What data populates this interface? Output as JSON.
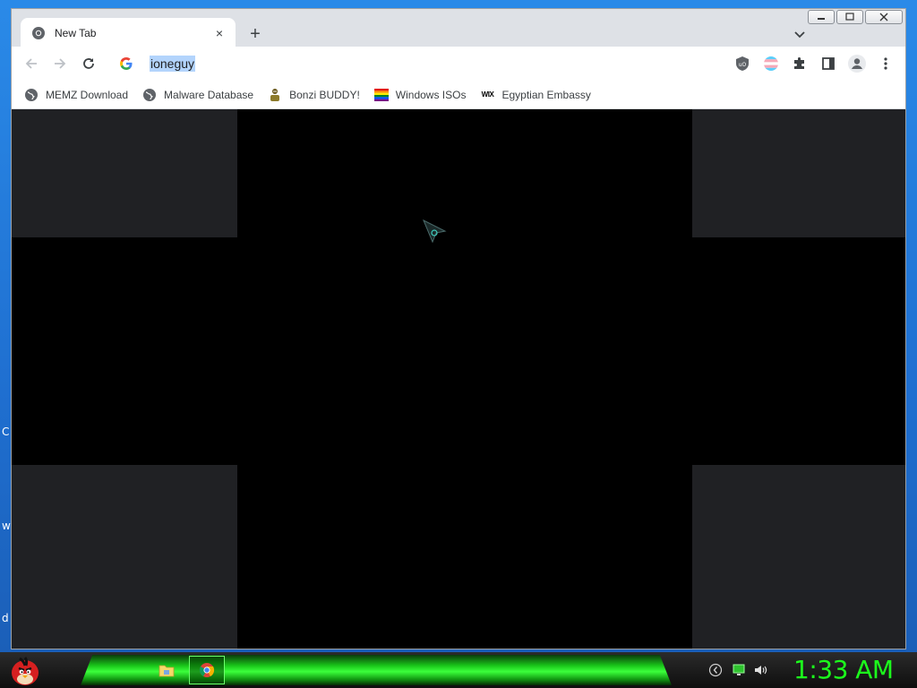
{
  "desktop": {
    "fragments": [
      "C",
      "w",
      "d"
    ]
  },
  "window": {
    "tab": {
      "title": "New Tab",
      "close_glyph": "×"
    },
    "new_tab_glyph": "+",
    "omnibox": {
      "value": "ioneguy"
    },
    "bookmarks": [
      {
        "label": "MEMZ Download",
        "icon": "globe-icon"
      },
      {
        "label": "Malware Database",
        "icon": "globe-icon"
      },
      {
        "label": "Bonzi BUDDY!",
        "icon": "bonzi-icon"
      },
      {
        "label": "Windows ISOs",
        "icon": "rainbow-flag-icon"
      },
      {
        "label": "Egyptian Embassy",
        "icon": "wix-icon",
        "icon_text": "WIX"
      }
    ],
    "extensions": [
      "ublock-icon",
      "trans-flag-icon",
      "puzzle-icon",
      "side-panel-icon",
      "profile-icon",
      "kebab-menu-icon"
    ]
  },
  "taskbar": {
    "clock": "1:33 AM",
    "apps": [
      "file-explorer-icon",
      "chrome-icon"
    ],
    "tray": [
      "keyboard-icon",
      "network-icon",
      "volume-icon"
    ]
  },
  "colors": {
    "chrome_frame": "#dee1e6",
    "page_bg": "#000000",
    "corner_panel": "#202124",
    "taskbar_accent": "#1cff1c",
    "selection": "#b3d4fc"
  }
}
